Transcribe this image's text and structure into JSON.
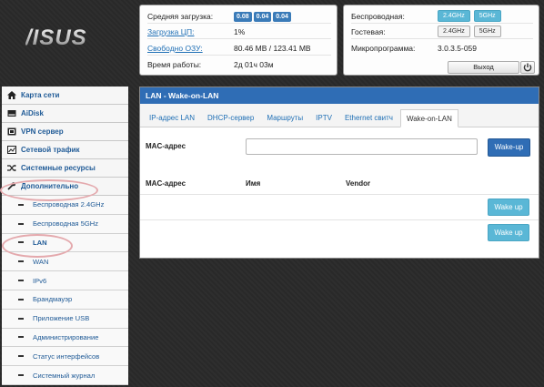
{
  "logo": {
    "text": "/ISUS"
  },
  "system": {
    "cpu_load_label": "Средняя загрузка:",
    "cpu_load_values": [
      "0.08",
      "0.04",
      "0.04"
    ],
    "cpu_usage_label": "Загрузка ЦП:",
    "cpu_usage_value": "1%",
    "ram_label": "Свободно ОЗУ:",
    "ram_value": "80.46 MB / 123.41 MB",
    "uptime_label": "Время работы:",
    "uptime_value": "2д 01ч 03м"
  },
  "network": {
    "wireless_label": "Беспроводная:",
    "wireless_bands": [
      "2.4GHz",
      "5GHz"
    ],
    "guest_label": "Гостевая:",
    "guest_bands": [
      "2.4GHz",
      "5GHz"
    ],
    "firmware_label": "Микропрограмма:",
    "firmware_value": "3.0.3.5-059",
    "exit_label": "Выход"
  },
  "sidebar": {
    "items": [
      {
        "label": "Карта сети",
        "icon": "home-icon"
      },
      {
        "label": "AiDisk",
        "icon": "disk-icon"
      },
      {
        "label": "VPN сервер",
        "icon": "vpn-icon"
      },
      {
        "label": "Сетевой трафик",
        "icon": "traffic-icon"
      },
      {
        "label": "Системные ресурсы",
        "icon": "shuffle-icon"
      },
      {
        "label": "Дополнительно",
        "icon": "wrench-icon"
      }
    ],
    "subitems": [
      "Беспроводная 2.4GHz",
      "Беспроводная 5GHz",
      "LAN",
      "WAN",
      "IPv6",
      "Брандмауэр",
      "Приложение USB",
      "Администрирование",
      "Статус интерфейсов",
      "Системный журнал"
    ]
  },
  "main": {
    "title": "LAN - Wake-on-LAN",
    "tabs": [
      "IP-адрес LAN",
      "DHCP-сервер",
      "Маршруты",
      "IPTV",
      "Ethernet свитч",
      "Wake-on-LAN"
    ],
    "mac_label": "MAC-адрес",
    "mac_value": "",
    "wake_button": "Wake-up",
    "table_headers": [
      "MAC-адрес",
      "Имя",
      "Vendor"
    ],
    "row_button": "Wake up"
  },
  "colors": {
    "accent": "#2f6db5",
    "badge": "#3a7bb8",
    "band_on": "#5ab7d6",
    "highlight": "#e4a9ad"
  }
}
